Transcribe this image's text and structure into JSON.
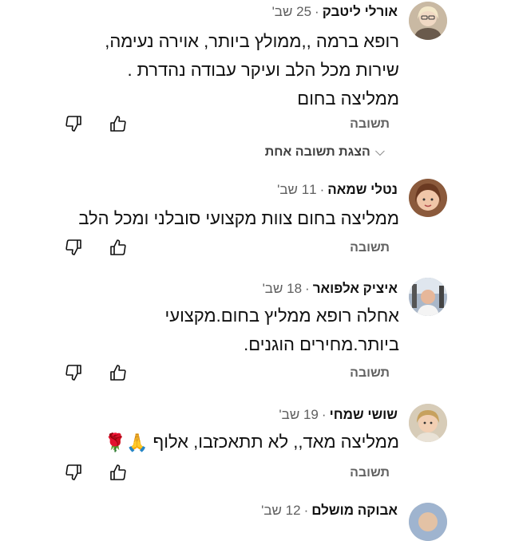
{
  "comments": [
    {
      "author": "אורלי ליטבק",
      "time": "25 שב'",
      "lines": [
        "רופא ברמה ,,ממולץ ביותר, אוירה נעימה,",
        "שירות מכל הלב ועיקר עבודה נהדרת .",
        "ממליצה בחום"
      ],
      "reply_label": "תשובה"
    },
    {
      "author": "נטלי שמאה",
      "time": "11 שב'",
      "lines": [
        "ממליצה בחום צוות מקצועי סובלני ומכל הלב"
      ],
      "reply_label": "תשובה"
    },
    {
      "author": "איציק אלפואר",
      "time": "18 שב'",
      "lines": [
        "אחלה רופא ממליץ בחום.מקצועי",
        "ביותר.מחירים הוגנים."
      ],
      "reply_label": "תשובה"
    },
    {
      "author": "שושי שמחי",
      "time": "19 שב'",
      "lines": [
        "ממליצה מאד,, לא תתאכזבו, אלוף"
      ],
      "emojis": "🙏🌹",
      "reply_label": "תשובה"
    },
    {
      "author": "אבוקה מושלם",
      "time": "12 שב'"
    }
  ],
  "show_replies": {
    "label": "הצגת תשובה אחת"
  },
  "separator": "·",
  "icons": {
    "like": "thumb-up-icon",
    "dislike": "thumb-down-icon",
    "expand": "chevron-down-icon"
  }
}
